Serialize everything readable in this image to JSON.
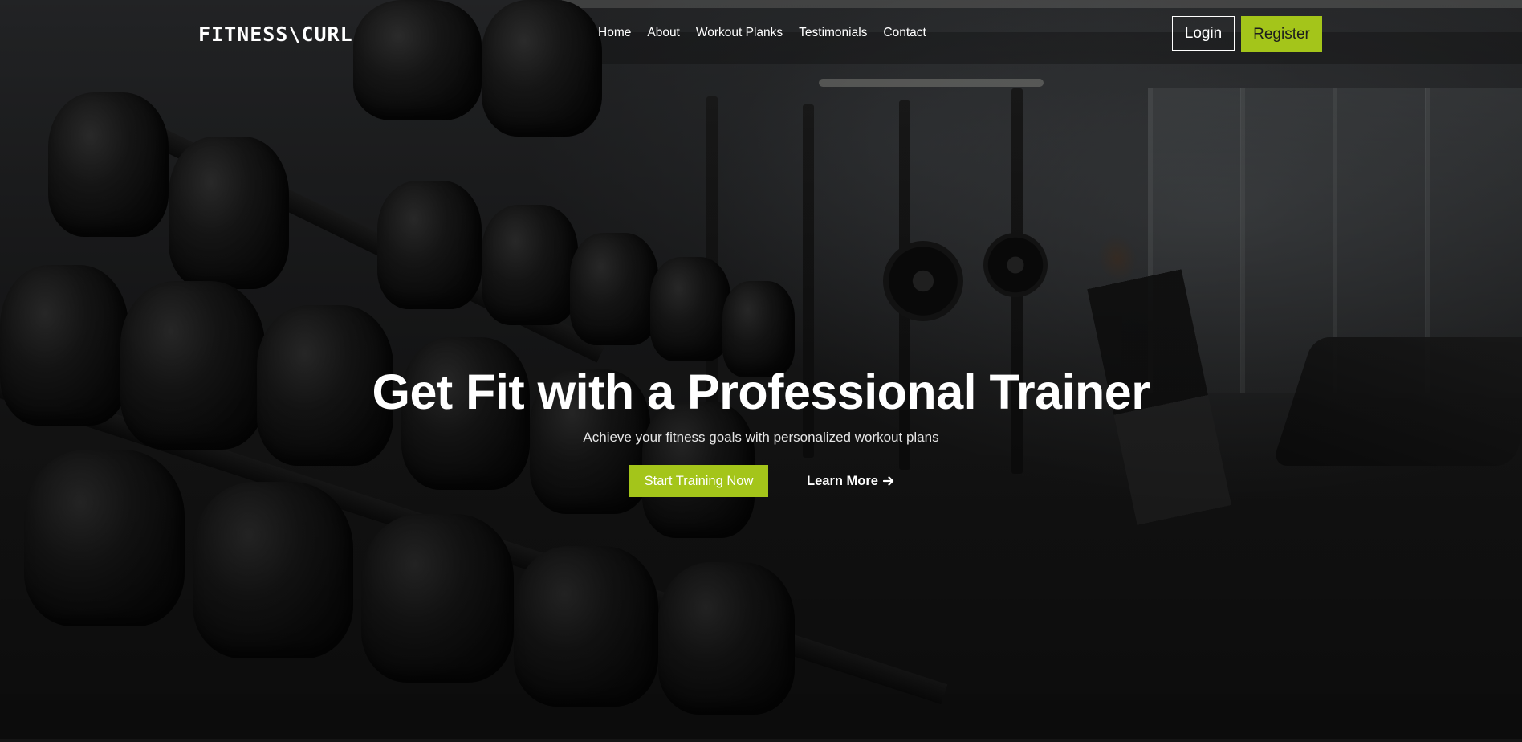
{
  "brand": {
    "logo_text": "FITNESS\\CURL"
  },
  "nav": {
    "links": [
      "Home",
      "About",
      "Workout Planks",
      "Testimonials",
      "Contact"
    ]
  },
  "auth": {
    "login_label": "Login",
    "register_label": "Register"
  },
  "hero": {
    "title": "Get Fit with a Professional Trainer",
    "subtitle": "Achieve your fitness goals with personalized workout plans",
    "primary_cta": "Start Training Now",
    "secondary_cta": "Learn More",
    "secondary_cta_icon": "arrow-right-icon"
  },
  "colors": {
    "accent": "#a4c51a",
    "text": "#ffffff",
    "background": "#1b1b1b"
  }
}
